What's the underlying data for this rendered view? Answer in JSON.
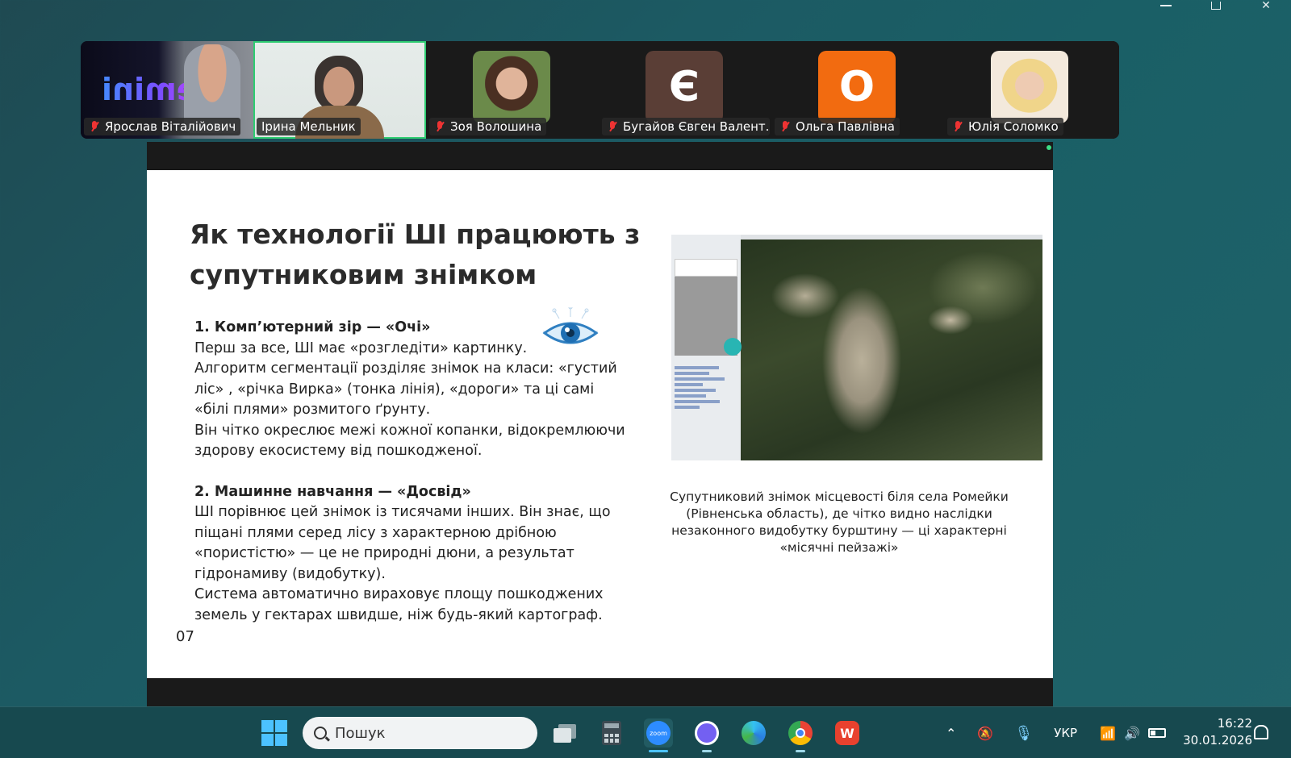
{
  "window": {
    "controls": [
      "minimize",
      "maximize",
      "close"
    ]
  },
  "participants": [
    {
      "name": "Ярослав Віталійович",
      "muted": true,
      "kind": "video",
      "overlay_text": "Gemini"
    },
    {
      "name": "Ірина Мельник",
      "muted": false,
      "kind": "video",
      "active": true
    },
    {
      "name": "Зоя Волошина",
      "muted": true,
      "kind": "photo"
    },
    {
      "name": "Бугайов Євген Валент...",
      "muted": true,
      "kind": "letter",
      "letter": "Є",
      "color": "#5a3e36"
    },
    {
      "name": "Ольга Павлівна",
      "muted": true,
      "kind": "letter",
      "letter": "О",
      "color": "#f26b10"
    },
    {
      "name": "Юлія Соломко",
      "muted": true,
      "kind": "photo"
    }
  ],
  "slide": {
    "title": "Як технології ШІ працюють з супутниковим знімком",
    "section1_heading": "1. Комп’ютерний зір — «Очі»",
    "section1_lines": [
      "Перш за все, ШІ має «розгледіти» картинку.",
      "Алгоритм сегментації розділяє знімок на класи: «густий ліс» , «річка Вирка» (тонка лінія), «дороги» та ці самі «білі плями» розмитого ґрунту.",
      "Він чітко окреслює межі кожної копанки, відокремлюючи здорову екосистему від пошкодженої."
    ],
    "section2_heading": "2. Машинне навчання — «Досвід»",
    "section2_lines": [
      "ШІ порівнює цей знімок із тисячами інших. Він знає, що піщані плями серед лісу з характерною дрібною «пористістю» — це не природні дюни, а результат гідронамиву (видобутку).",
      "Система автоматично вираховує площу пошкоджених земель у гектарах швидше, ніж будь-який картограф."
    ],
    "page_number": "07",
    "caption": "Супутниковий знімок місцевості біля села Ромейки (Рівненська область), де чітко видно наслідки незаконного видобутку бурштину — ці характерні «місячні пейзажі»"
  },
  "taskbar": {
    "search_placeholder": "Пошук",
    "apps": [
      "task-view",
      "calculator",
      "zoom",
      "viber",
      "edge",
      "chrome",
      "wps-office"
    ],
    "language": "УКР",
    "time": "16:22",
    "date": "30.01.2026"
  }
}
